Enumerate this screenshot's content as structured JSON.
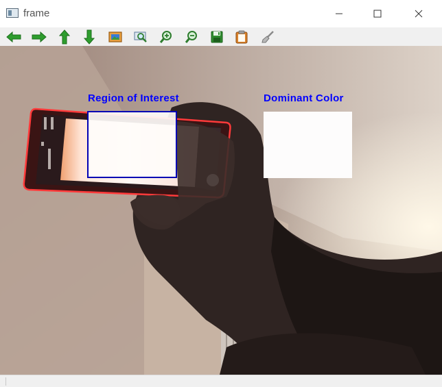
{
  "window": {
    "title": "frame",
    "controls": [
      "minimize-icon",
      "maximize-icon",
      "close-icon"
    ]
  },
  "toolbar": {
    "buttons": [
      {
        "name": "pan-left",
        "icon": "arrow-left-icon",
        "color": "#2e9d2e"
      },
      {
        "name": "pan-right",
        "icon": "arrow-right-icon",
        "color": "#2e9d2e"
      },
      {
        "name": "pan-up",
        "icon": "arrow-up-icon",
        "color": "#2e9d2e"
      },
      {
        "name": "pan-down",
        "icon": "arrow-down-icon",
        "color": "#2e9d2e"
      },
      {
        "name": "zoom-original",
        "icon": "image-icon",
        "color": "#c06a1a"
      },
      {
        "name": "zoom-fit",
        "icon": "zoom-rect-icon",
        "color": "#2e7d2e"
      },
      {
        "name": "zoom-in",
        "icon": "zoom-in-icon",
        "color": "#2e7d2e"
      },
      {
        "name": "zoom-out",
        "icon": "zoom-out-icon",
        "color": "#2e7d2e"
      },
      {
        "name": "save",
        "icon": "save-icon",
        "color": "#2e7d2e"
      },
      {
        "name": "copy",
        "icon": "clipboard-icon",
        "color": "#c06a1a"
      },
      {
        "name": "properties",
        "icon": "brush-icon",
        "color": "#888888"
      }
    ]
  },
  "frame": {
    "roi_label": "Region of Interest",
    "dominant_label": "Dominant Color",
    "roi_box_color": "#0000b4",
    "label_color": "#0000ff",
    "dominant_color": "#fdfcfc"
  }
}
